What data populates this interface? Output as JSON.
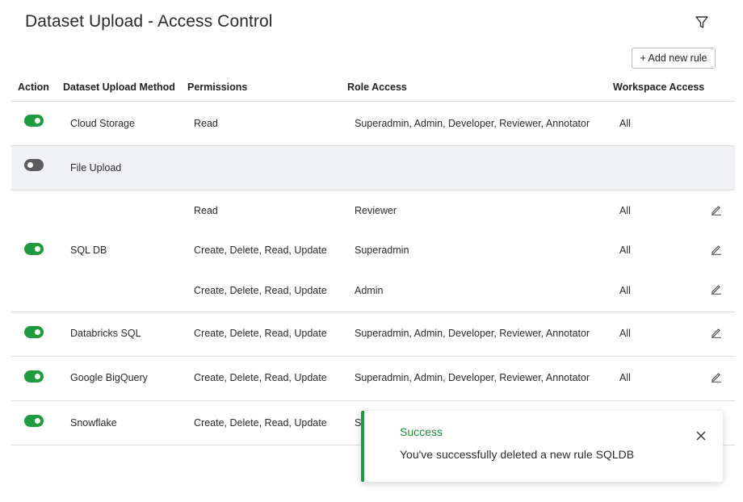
{
  "page": {
    "title": "Dataset Upload - Access Control"
  },
  "toolbar": {
    "add_rule_label": "+ Add new rule",
    "filter_icon": "filter-icon"
  },
  "table": {
    "headers": {
      "action": "Action",
      "method": "Dataset Upload Method",
      "permissions": "Permissions",
      "role_access": "Role Access",
      "workspace_access": "Workspace Access"
    },
    "rows": [
      {
        "method": "Cloud Storage",
        "enabled": true,
        "rules": [
          {
            "permissions": "Read",
            "roles": "Superadmin, Admin, Developer, Reviewer, Annotator",
            "workspace": "All",
            "editable": false
          }
        ]
      },
      {
        "method": "File Upload",
        "enabled": false,
        "rules": []
      },
      {
        "method": "SQL DB",
        "enabled": true,
        "rules": [
          {
            "permissions": "Read",
            "roles": "Reviewer",
            "workspace": "All",
            "editable": true
          },
          {
            "permissions": "Create, Delete, Read, Update",
            "roles": "Superadmin",
            "workspace": "All",
            "editable": true
          },
          {
            "permissions": "Create, Delete, Read, Update",
            "roles": "Admin",
            "workspace": "All",
            "editable": true
          }
        ]
      },
      {
        "method": "Databricks SQL",
        "enabled": true,
        "rules": [
          {
            "permissions": "Create, Delete, Read, Update",
            "roles": "Superadmin, Admin, Developer, Reviewer, Annotator",
            "workspace": "All",
            "editable": true
          }
        ]
      },
      {
        "method": "Google BigQuery",
        "enabled": true,
        "rules": [
          {
            "permissions": "Create, Delete, Read, Update",
            "roles": "Superadmin, Admin, Developer, Reviewer, Annotator",
            "workspace": "All",
            "editable": true
          }
        ]
      },
      {
        "method": "Snowflake",
        "enabled": true,
        "rules": [
          {
            "permissions": "Create, Delete, Read, Update",
            "roles": "S",
            "workspace": "",
            "editable": false
          }
        ]
      }
    ]
  },
  "toast": {
    "title": "Success",
    "message": "You've successfully deleted a new rule SQLDB",
    "close_icon": "close-icon"
  },
  "colors": {
    "accent_green": "#1f9a3f",
    "toggle_off": "#5c5c5c",
    "disabled_row_bg": "#f1f2f6"
  }
}
